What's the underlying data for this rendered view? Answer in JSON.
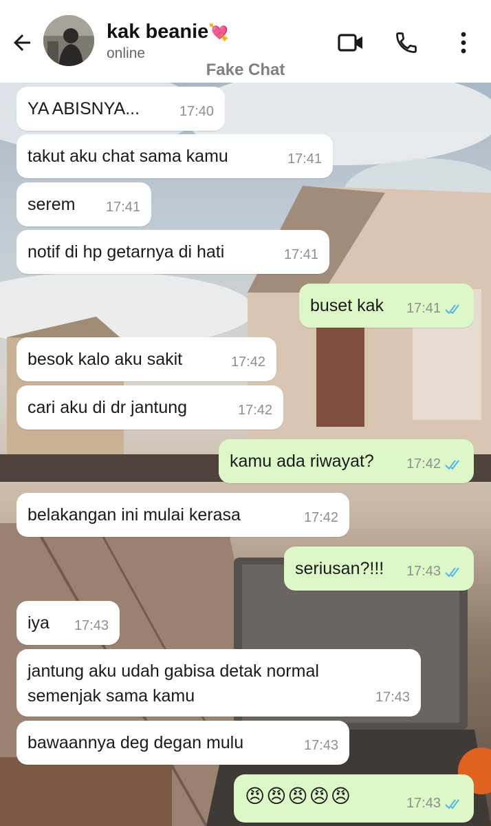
{
  "header": {
    "contact_name": "kak beanie",
    "name_emoji": "💘",
    "status": "online",
    "watermark": "Fake Chat"
  },
  "messages": [
    {
      "dir": "in",
      "text": "YA ABISNYA...",
      "time": "17:40"
    },
    {
      "dir": "in",
      "text": "takut aku chat sama kamu",
      "time": "17:41"
    },
    {
      "dir": "in",
      "text": "serem",
      "time": "17:41"
    },
    {
      "dir": "in",
      "text": "notif di hp getarnya di hati",
      "time": "17:41"
    },
    {
      "dir": "out",
      "text": "buset kak",
      "time": "17:41",
      "read": true
    },
    {
      "dir": "in",
      "text": "besok kalo aku sakit",
      "time": "17:42"
    },
    {
      "dir": "in",
      "text": "cari aku di dr jantung",
      "time": "17:42"
    },
    {
      "dir": "out",
      "text": "kamu ada riwayat?",
      "time": "17:42",
      "read": true
    },
    {
      "dir": "in",
      "text": "belakangan ini mulai kerasa",
      "time": "17:42"
    },
    {
      "dir": "out",
      "text": "seriusan?!!!",
      "time": "17:43",
      "read": true
    },
    {
      "dir": "in",
      "text": "iya",
      "time": "17:43"
    },
    {
      "dir": "in",
      "text": "jantung aku udah gabisa detak normal",
      "text2": "semenjak sama kamu",
      "time": "17:43"
    },
    {
      "dir": "in",
      "text": "bawaannya deg degan mulu",
      "time": "17:43"
    },
    {
      "dir": "out",
      "text": "😠😠😠😠😠",
      "time": "17:43",
      "read": true
    }
  ],
  "icons": {
    "back": "arrow-left-icon",
    "video": "video-camera-icon",
    "call": "phone-icon",
    "menu": "more-vertical-icon",
    "read_receipt": "double-check-icon"
  },
  "colors": {
    "incoming_bubble": "#ffffff",
    "outgoing_bubble": "#dcf8c6",
    "read_tick": "#4fb6ec"
  }
}
